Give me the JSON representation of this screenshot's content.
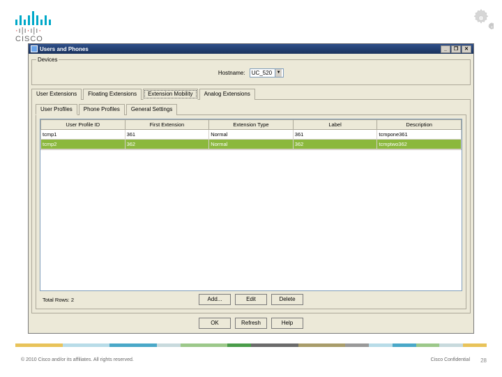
{
  "logo": {
    "text": "CISCO"
  },
  "titlebar": {
    "title": "Users and Phones",
    "min": "_",
    "max": "❐",
    "close": "✕"
  },
  "devices": {
    "legend": "Devices",
    "hostname_label": "Hostname:",
    "hostname_value": "UC_520"
  },
  "outer_tabs": [
    {
      "label": "User Extensions"
    },
    {
      "label": "Floating Extensions"
    },
    {
      "label": "Extension Mobility",
      "dotted": true
    },
    {
      "label": "Analog Extensions"
    }
  ],
  "inner_tabs": [
    {
      "label": "User Profiles",
      "active": true
    },
    {
      "label": "Phone Profiles"
    },
    {
      "label": "General Settings"
    }
  ],
  "table": {
    "headers": [
      "User Profile ID",
      "First Extension",
      "Extension Type",
      "Label",
      "Description"
    ],
    "rows": [
      {
        "cells": [
          "tcmp1",
          "361",
          "Normal",
          "361",
          "tcmpone361"
        ],
        "selected": false
      },
      {
        "cells": [
          "tcmp2",
          "362",
          "Normal",
          "362",
          "tcmptwo362"
        ],
        "selected": true
      }
    ]
  },
  "total_rows_label": "Total Rows: 2",
  "buttons": {
    "add": "Add...",
    "edit": "Edit",
    "delete": "Delete",
    "ok": "OK",
    "refresh": "Refresh",
    "help": "Help"
  },
  "footer": {
    "left": "© 2010 Cisco and/or its affiliates. All rights reserved.",
    "right": "Cisco Confidential",
    "slide": "28"
  },
  "color_bar": [
    "#e8c35a",
    "#e8c35a",
    "#b8dce8",
    "#b8dce8",
    "#4aa8c8",
    "#4aa8c8",
    "#c8dadd",
    "#9cc88a",
    "#9cc88a",
    "#4a9c4a",
    "#6b6b6b",
    "#6b6b6b",
    "#a89c6a",
    "#a89c6a",
    "#999",
    "#b8dce8",
    "#4aa8c8",
    "#9cc88a",
    "#c8dadd",
    "#e8c35a"
  ]
}
